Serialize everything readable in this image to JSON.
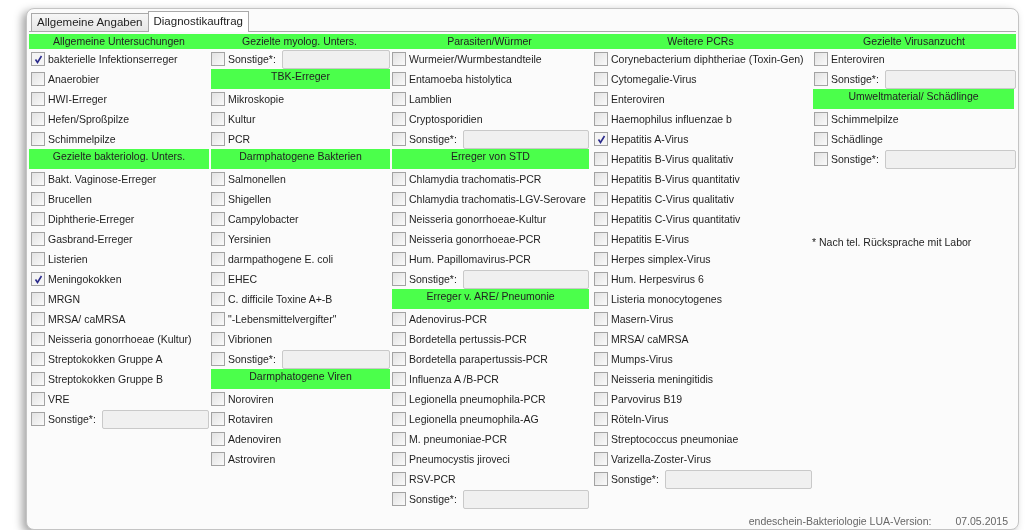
{
  "tabs": [
    {
      "label": "Allgemeine Angaben",
      "selected": false
    },
    {
      "label": "Diagnostikauftrag",
      "selected": true
    }
  ],
  "columns": [
    {
      "items": [
        {
          "kind": "header",
          "label": "Allgemeine Untersuchungen"
        },
        {
          "kind": "checkbox",
          "label": "bakterielle Infektionserreger",
          "checked": true
        },
        {
          "kind": "checkbox",
          "label": "Anaerobier",
          "checked": false
        },
        {
          "kind": "checkbox",
          "label": "HWI-Erreger",
          "checked": false
        },
        {
          "kind": "checkbox",
          "label": "Hefen/Sproßpilze",
          "checked": false
        },
        {
          "kind": "checkbox",
          "label": "Schimmelpilze",
          "checked": false
        },
        {
          "kind": "header",
          "label": "Gezielte bakteriolog. Unters."
        },
        {
          "kind": "checkbox",
          "label": "Bakt. Vaginose-Erreger",
          "checked": false
        },
        {
          "kind": "checkbox",
          "label": "Brucellen",
          "checked": false
        },
        {
          "kind": "checkbox",
          "label": "Diphtherie-Erreger",
          "checked": false
        },
        {
          "kind": "checkbox",
          "label": "Gasbrand-Erreger",
          "checked": false
        },
        {
          "kind": "checkbox",
          "label": "Listerien",
          "checked": false
        },
        {
          "kind": "checkbox",
          "label": "Meningokokken",
          "checked": true
        },
        {
          "kind": "checkbox",
          "label": "MRGN",
          "checked": false
        },
        {
          "kind": "checkbox",
          "label": "MRSA/ caMRSA",
          "checked": false
        },
        {
          "kind": "checkbox",
          "label": "Neisseria gonorrhoeae (Kultur)",
          "checked": false
        },
        {
          "kind": "checkbox",
          "label": "Streptokokken Gruppe A",
          "checked": false
        },
        {
          "kind": "checkbox",
          "label": "Streptokokken Gruppe B",
          "checked": false
        },
        {
          "kind": "checkbox",
          "label": "VRE",
          "checked": false
        },
        {
          "kind": "other",
          "label": "Sonstige*:",
          "checked": false
        }
      ]
    },
    {
      "items": [
        {
          "kind": "header",
          "label": "Gezielte myolog. Unters."
        },
        {
          "kind": "other",
          "label": "Sonstige*:",
          "checked": false
        },
        {
          "kind": "header",
          "label": "TBK-Erreger"
        },
        {
          "kind": "checkbox",
          "label": "Mikroskopie",
          "checked": false
        },
        {
          "kind": "checkbox",
          "label": "Kultur",
          "checked": false
        },
        {
          "kind": "checkbox",
          "label": "PCR",
          "checked": false
        },
        {
          "kind": "header",
          "label": "Darmphatogene Bakterien"
        },
        {
          "kind": "checkbox",
          "label": "Salmonellen",
          "checked": false
        },
        {
          "kind": "checkbox",
          "label": "Shigellen",
          "checked": false
        },
        {
          "kind": "checkbox",
          "label": "Campylobacter",
          "checked": false
        },
        {
          "kind": "checkbox",
          "label": "Yersinien",
          "checked": false
        },
        {
          "kind": "checkbox",
          "label": "darmpathogene E. coli",
          "checked": false
        },
        {
          "kind": "checkbox",
          "label": "EHEC",
          "checked": false
        },
        {
          "kind": "checkbox",
          "label": "C. difficile Toxine A+-B",
          "checked": false
        },
        {
          "kind": "checkbox",
          "label": "\"-Lebensmittelvergifter\"",
          "checked": false
        },
        {
          "kind": "checkbox",
          "label": "Vibrionen",
          "checked": false
        },
        {
          "kind": "other",
          "label": "Sonstige*:",
          "checked": false
        },
        {
          "kind": "header",
          "label": "Darmphatogene Viren"
        },
        {
          "kind": "checkbox",
          "label": "Noroviren",
          "checked": false
        },
        {
          "kind": "checkbox",
          "label": "Rotaviren",
          "checked": false
        },
        {
          "kind": "checkbox",
          "label": "Adenoviren",
          "checked": false
        },
        {
          "kind": "checkbox",
          "label": "Astroviren",
          "checked": false
        }
      ]
    },
    {
      "items": [
        {
          "kind": "header",
          "label": "Parasiten/Würmer"
        },
        {
          "kind": "checkbox",
          "label": "Wurmeier/Wurmbestandteile",
          "checked": false
        },
        {
          "kind": "checkbox",
          "label": "Entamoeba histolytica",
          "checked": false
        },
        {
          "kind": "checkbox",
          "label": "Lamblien",
          "checked": false
        },
        {
          "kind": "checkbox",
          "label": "Cryptosporidien",
          "checked": false
        },
        {
          "kind": "other",
          "label": "Sonstige*:",
          "checked": false
        },
        {
          "kind": "header",
          "label": "Erreger von STD"
        },
        {
          "kind": "checkbox",
          "label": "Chlamydia trachomatis-PCR",
          "checked": false
        },
        {
          "kind": "checkbox",
          "label": "Chlamydia trachomatis-LGV-Serovare",
          "checked": false
        },
        {
          "kind": "checkbox",
          "label": "Neisseria gonorrhoeae-Kultur",
          "checked": false
        },
        {
          "kind": "checkbox",
          "label": "Neisseria gonorrhoeae-PCR",
          "checked": false
        },
        {
          "kind": "checkbox",
          "label": "Hum. Papillomavirus-PCR",
          "checked": false
        },
        {
          "kind": "other",
          "label": "Sonstige*:",
          "checked": false
        },
        {
          "kind": "header",
          "label": "Erreger v. ARE/ Pneumonie"
        },
        {
          "kind": "checkbox",
          "label": "Adenovirus-PCR",
          "checked": false
        },
        {
          "kind": "checkbox",
          "label": "Bordetella pertussis-PCR",
          "checked": false
        },
        {
          "kind": "checkbox",
          "label": "Bordetella parapertussis-PCR",
          "checked": false
        },
        {
          "kind": "checkbox",
          "label": "Influenza A /B-PCR",
          "checked": false
        },
        {
          "kind": "checkbox",
          "label": "Legionella pneumophila-PCR",
          "checked": false
        },
        {
          "kind": "checkbox",
          "label": "Legionella pneumophila-AG",
          "checked": false
        },
        {
          "kind": "checkbox",
          "label": "M. pneumoniae-PCR",
          "checked": false
        },
        {
          "kind": "checkbox",
          "label": "Pneumocystis jiroveci",
          "checked": false
        },
        {
          "kind": "checkbox",
          "label": "RSV-PCR",
          "checked": false
        },
        {
          "kind": "other",
          "label": "Sonstige*:",
          "checked": false
        }
      ]
    },
    {
      "items": [
        {
          "kind": "header",
          "label": "Weitere PCRs"
        },
        {
          "kind": "checkbox",
          "label": "Corynebacterium diphtheriae (Toxin-Gen)",
          "checked": false
        },
        {
          "kind": "checkbox",
          "label": "Cytomegalie-Virus",
          "checked": false
        },
        {
          "kind": "checkbox",
          "label": "Enteroviren",
          "checked": false
        },
        {
          "kind": "checkbox",
          "label": "Haemophilus influenzae b",
          "checked": false
        },
        {
          "kind": "checkbox",
          "label": "Hepatitis A-Virus",
          "checked": true
        },
        {
          "kind": "checkbox",
          "label": "Hepatitis B-Virus qualitativ",
          "checked": false
        },
        {
          "kind": "checkbox",
          "label": "Hepatitis B-Virus quantitativ",
          "checked": false
        },
        {
          "kind": "checkbox",
          "label": "Hepatitis C-Virus qualitativ",
          "checked": false
        },
        {
          "kind": "checkbox",
          "label": "Hepatitis C-Virus quantitativ",
          "checked": false
        },
        {
          "kind": "checkbox",
          "label": "Hepatitis E-Virus",
          "checked": false
        },
        {
          "kind": "checkbox",
          "label": "Herpes simplex-Virus",
          "checked": false
        },
        {
          "kind": "checkbox",
          "label": "Hum. Herpesvirus 6",
          "checked": false
        },
        {
          "kind": "checkbox",
          "label": "Listeria monocytogenes",
          "checked": false
        },
        {
          "kind": "checkbox",
          "label": "Masern-Virus",
          "checked": false
        },
        {
          "kind": "checkbox",
          "label": "MRSA/ caMRSA",
          "checked": false
        },
        {
          "kind": "checkbox",
          "label": "Mumps-Virus",
          "checked": false
        },
        {
          "kind": "checkbox",
          "label": "Neisseria meningitidis",
          "checked": false
        },
        {
          "kind": "checkbox",
          "label": "Parvovirus B19",
          "checked": false
        },
        {
          "kind": "checkbox",
          "label": "Röteln-Virus",
          "checked": false
        },
        {
          "kind": "checkbox",
          "label": "Streptococcus pneumoniae",
          "checked": false
        },
        {
          "kind": "checkbox",
          "label": "Varizella-Zoster-Virus",
          "checked": false
        },
        {
          "kind": "other",
          "label": "Sonstige*:",
          "checked": false
        }
      ]
    },
    {
      "items": [
        {
          "kind": "header",
          "label": "Gezielte Virusanzucht"
        },
        {
          "kind": "checkbox",
          "label": "Enteroviren",
          "checked": false
        },
        {
          "kind": "other",
          "label": "Sonstige*:",
          "checked": false
        },
        {
          "kind": "header",
          "label": "Umweltmaterial/ Schädlinge"
        },
        {
          "kind": "checkbox",
          "label": "Schimmelpilze",
          "checked": false
        },
        {
          "kind": "checkbox",
          "label": "Schädlinge",
          "checked": false
        },
        {
          "kind": "other",
          "label": "Sonstige*:",
          "checked": false
        },
        {
          "kind": "note",
          "label": "* Nach tel. Rücksprache mit Labor"
        }
      ]
    }
  ],
  "footer": {
    "version_label": "endeschein-Bakteriologie LUA-Version:",
    "version_date": "07.05.2015"
  }
}
